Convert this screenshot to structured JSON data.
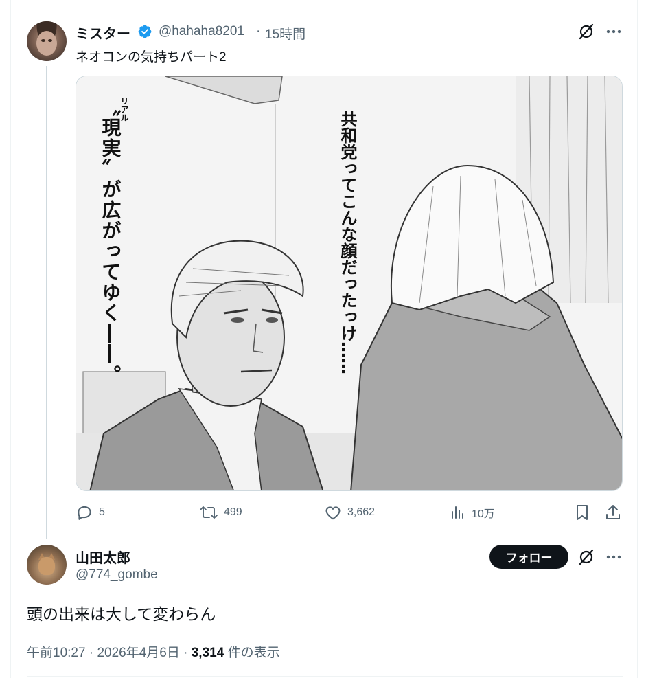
{
  "tweet": {
    "author": {
      "display_name": "ミスター",
      "handle": "@hahaha8201",
      "verified": true,
      "avatar_icon": "avatar-photo"
    },
    "separator": "·",
    "time_ago": "15時間",
    "text": "ネオコンの気持ちパート2",
    "media": {
      "caption_vertical_left": "〝現実〟が広がってゆく――。",
      "caption_vertical_left_ruby": "リアル",
      "caption_vertical_right": "共和党ってこんな顔だったっけ……"
    },
    "actions": {
      "replies": "5",
      "retweets": "499",
      "likes": "3,662",
      "views": "10万"
    }
  },
  "reply": {
    "author": {
      "display_name": "山田太郎",
      "handle": "@774_gombe",
      "avatar_icon": "avatar-cat-photo"
    },
    "follow_label": "フォロー",
    "text": "頭の出来は大して変わらん",
    "meta": {
      "time": "午前10:27",
      "separator": "·",
      "date": "2026年4月6日",
      "separator2": "·",
      "view_count": "3,314",
      "view_suffix": "件の表示"
    }
  },
  "icons": {
    "grok": "grok-slash-icon",
    "more": "more-dots-icon",
    "reply": "reply-bubble-icon",
    "retweet": "retweet-icon",
    "like": "heart-icon",
    "views": "analytics-bars-icon",
    "bookmark": "bookmark-icon",
    "share": "share-upload-icon"
  },
  "colors": {
    "text_primary": "#0f1419",
    "text_secondary": "#536471",
    "verified_blue": "#1d9bf0",
    "border": "#cfd9de"
  }
}
